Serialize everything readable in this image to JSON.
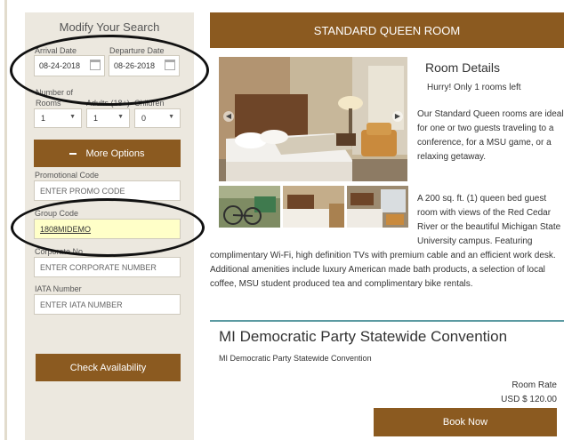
{
  "search": {
    "title": "Modify Your Search",
    "arrival_label": "Arrival Date",
    "arrival_value": "08-24-2018",
    "departure_label": "Departure Date",
    "departure_value": "08-26-2018",
    "rooms_label": "Number of Rooms",
    "rooms_label_line1": "Number of",
    "rooms_label_line2": "Rooms",
    "rooms_value": "1",
    "adults_label": "Adults (18+)",
    "adults_value": "1",
    "children_label": "Children",
    "children_value": "0",
    "more_options_label": "More Options",
    "promo_label": "Promotional Code",
    "promo_placeholder": "ENTER PROMO CODE",
    "group_label": "Group Code",
    "group_value": "1808MIDEMO",
    "corporate_label": "Corporate No.",
    "corporate_placeholder": "ENTER CORPORATE NUMBER",
    "iata_label": "IATA Number",
    "iata_placeholder": "ENTER IATA NUMBER",
    "check_button": "Check Availability"
  },
  "room": {
    "header": "STANDARD QUEEN ROOM",
    "details_title": "Room Details",
    "availability": "Hurry! Only 1 rooms left",
    "desc1": "Our Standard Queen rooms are ideal for one or two guests traveling to a conference, for a MSU game, or a relaxing getaway.",
    "desc2_right": "A 200 sq. ft. (1) queen bed guest room with views of the Red Cedar River or the beautiful Michigan State University campus. Featuring",
    "desc2_full": "complimentary Wi-Fi, high definition TVs with premium cable and an efficient work desk. Additional amenities include luxury American made bath products, a selection of local coffee, MSU student produced tea and complimentary bike rentals."
  },
  "event": {
    "title": "MI Democratic Party Statewide Convention",
    "subtitle": "MI Democratic Party Statewide Convention",
    "rate_label": "Room Rate",
    "rate_value": "USD $ 120.00",
    "book_button": "Book Now"
  },
  "colors": {
    "brand": "#8b5a20",
    "sidebar_bg": "#ece8df",
    "divider": "#5b9aa2",
    "group_highlight": "#ffffc8"
  }
}
